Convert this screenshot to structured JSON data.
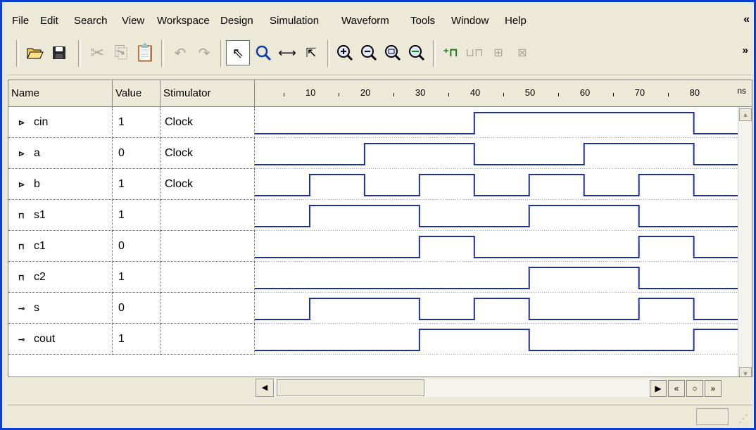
{
  "menu": {
    "items": [
      "File",
      "Edit",
      "Search",
      "View",
      "Workspace",
      "Design",
      "Simulation",
      "Waveform",
      "Tools",
      "Window",
      "Help"
    ],
    "chevron": "«"
  },
  "toolbar": {
    "chevron": "»",
    "icons": [
      "open-folder-icon",
      "save-icon",
      "cut-icon",
      "copy-icon",
      "paste-icon",
      "undo-icon",
      "redo-icon",
      "select-pointer-icon",
      "zoom-icon",
      "measure-icon",
      "cursor-region-icon",
      "zoom-in-icon",
      "zoom-out-icon",
      "zoom-fit-icon",
      "zoom-range-icon",
      "add-signal-icon",
      "add-waveform-icon",
      "bus-icon",
      "clock-stimulator-icon"
    ]
  },
  "header": {
    "name": "Name",
    "value": "Value",
    "stimulator": "Stimulator",
    "unit": "ns",
    "ticks": [
      "10",
      "20",
      "30",
      "40",
      "50",
      "60",
      "70",
      "80"
    ]
  },
  "signals": [
    {
      "name": "cin",
      "value": "1",
      "stimulator": "Clock",
      "kind": "input",
      "edges": [
        0,
        40,
        80
      ],
      "initial": 0
    },
    {
      "name": "a",
      "value": "0",
      "stimulator": "Clock",
      "kind": "input",
      "edges": [
        0,
        20,
        40,
        60,
        80
      ],
      "initial": 0
    },
    {
      "name": "b",
      "value": "1",
      "stimulator": "Clock",
      "kind": "input",
      "edges": [
        0,
        10,
        20,
        30,
        40,
        50,
        60,
        70,
        80
      ],
      "initial": 0
    },
    {
      "name": "s1",
      "value": "1",
      "stimulator": "",
      "kind": "internal",
      "edges": [
        0,
        10,
        30,
        50,
        70
      ],
      "initial": 0
    },
    {
      "name": "c1",
      "value": "0",
      "stimulator": "",
      "kind": "internal",
      "edges": [
        0,
        30,
        40,
        70,
        80
      ],
      "initial": 0
    },
    {
      "name": "c2",
      "value": "1",
      "stimulator": "",
      "kind": "internal",
      "edges": [
        0,
        50,
        70
      ],
      "initial": 0
    },
    {
      "name": "s",
      "value": "0",
      "stimulator": "",
      "kind": "output",
      "edges": [
        0,
        10,
        30,
        40,
        50,
        70,
        80
      ],
      "initial": 0
    },
    {
      "name": "cout",
      "value": "1",
      "stimulator": "",
      "kind": "output",
      "edges": [
        0,
        30,
        50,
        80
      ],
      "initial": 0
    }
  ],
  "time_range": [
    0,
    88
  ],
  "colors": {
    "wave": "#1f2e9e",
    "grid": "#9a9a9a",
    "title_border": "#0a3fd6"
  }
}
